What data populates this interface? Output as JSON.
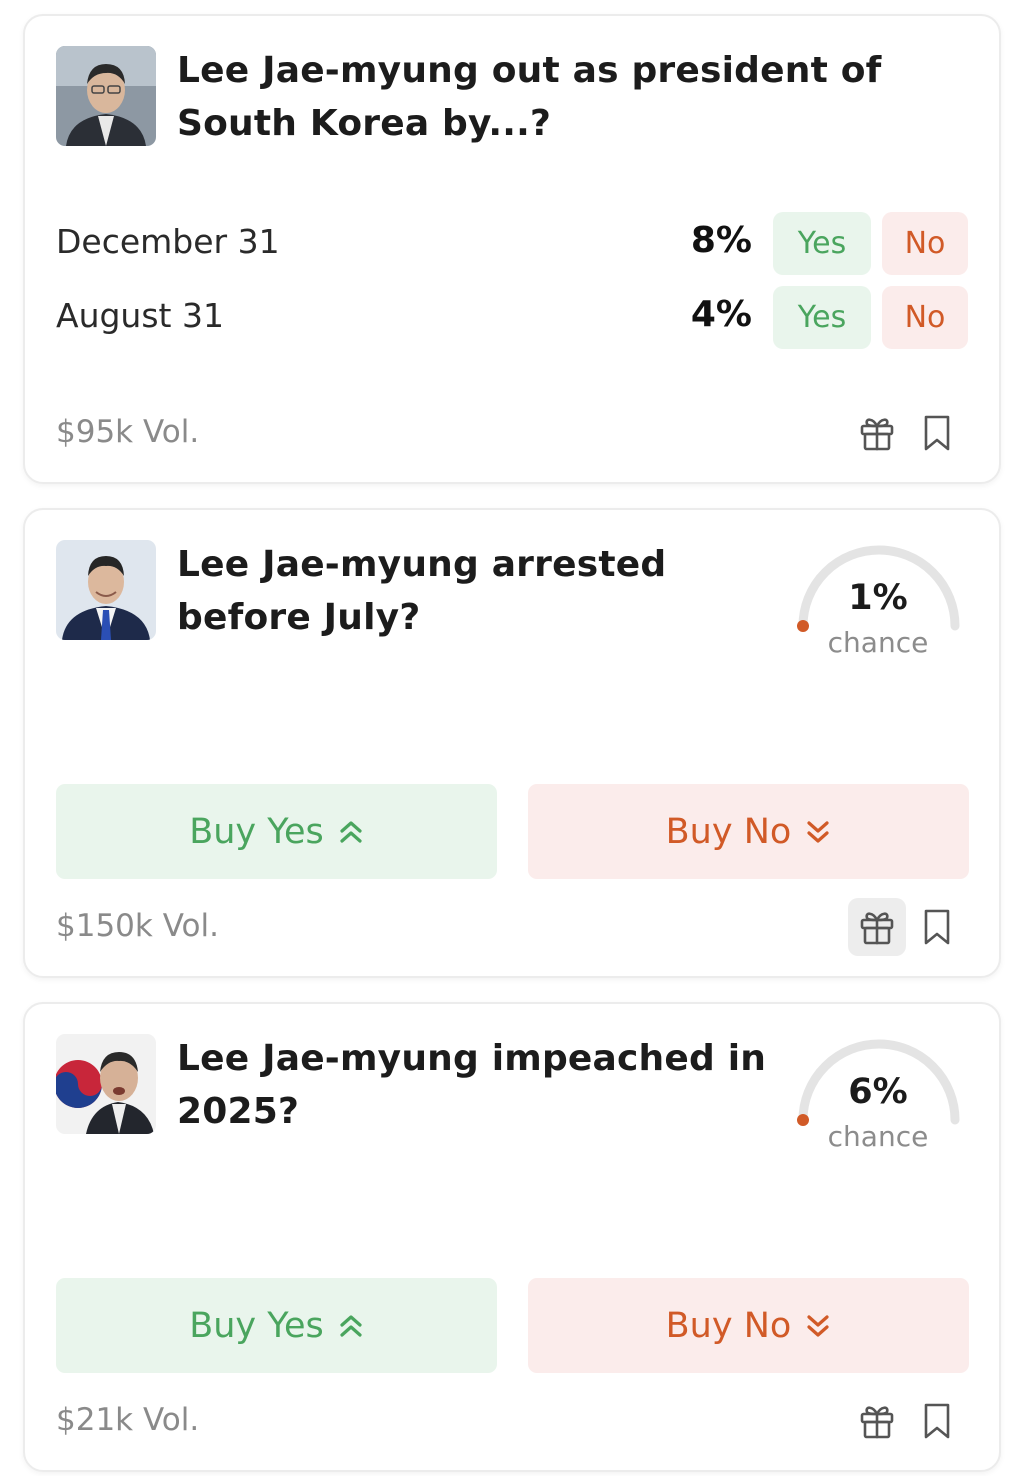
{
  "colors": {
    "yes_text": "#4aa55e",
    "yes_bg": "#e9f5ec",
    "no_text": "#d15a27",
    "no_bg": "#fbeceb",
    "gauge_track": "#e4e4e4",
    "gauge_dot": "#d15a27",
    "muted_text": "#8a8a8a"
  },
  "markets": [
    {
      "title": "Lee Jae-myung out as president of South Korea by...?",
      "thumbnail_icon": "portrait-photo",
      "outcomes": [
        {
          "label": "December 31",
          "percent": "8%",
          "yes_label": "Yes",
          "no_label": "No"
        },
        {
          "label": "August 31",
          "percent": "4%",
          "yes_label": "Yes",
          "no_label": "No"
        }
      ],
      "volume": "$95k Vol."
    },
    {
      "title": "Lee Jae-myung arrested before July?",
      "thumbnail_icon": "portrait-photo",
      "chance_value": 0.01,
      "chance_percent": "1%",
      "chance_label": "chance",
      "buy_yes_label": "Buy Yes",
      "buy_no_label": "Buy No",
      "volume": "$150k Vol."
    },
    {
      "title": "Lee Jae-myung impeached in 2025?",
      "thumbnail_icon": "portrait-photo-with-flag",
      "chance_value": 0.06,
      "chance_percent": "6%",
      "chance_label": "chance",
      "buy_yes_label": "Buy Yes",
      "buy_no_label": "Buy No",
      "volume": "$21k Vol."
    }
  ],
  "icons": {
    "gift": "gift-icon",
    "bookmark": "bookmark-icon",
    "up_chevrons": "double-chevron-up-icon",
    "down_chevrons": "double-chevron-down-icon"
  }
}
